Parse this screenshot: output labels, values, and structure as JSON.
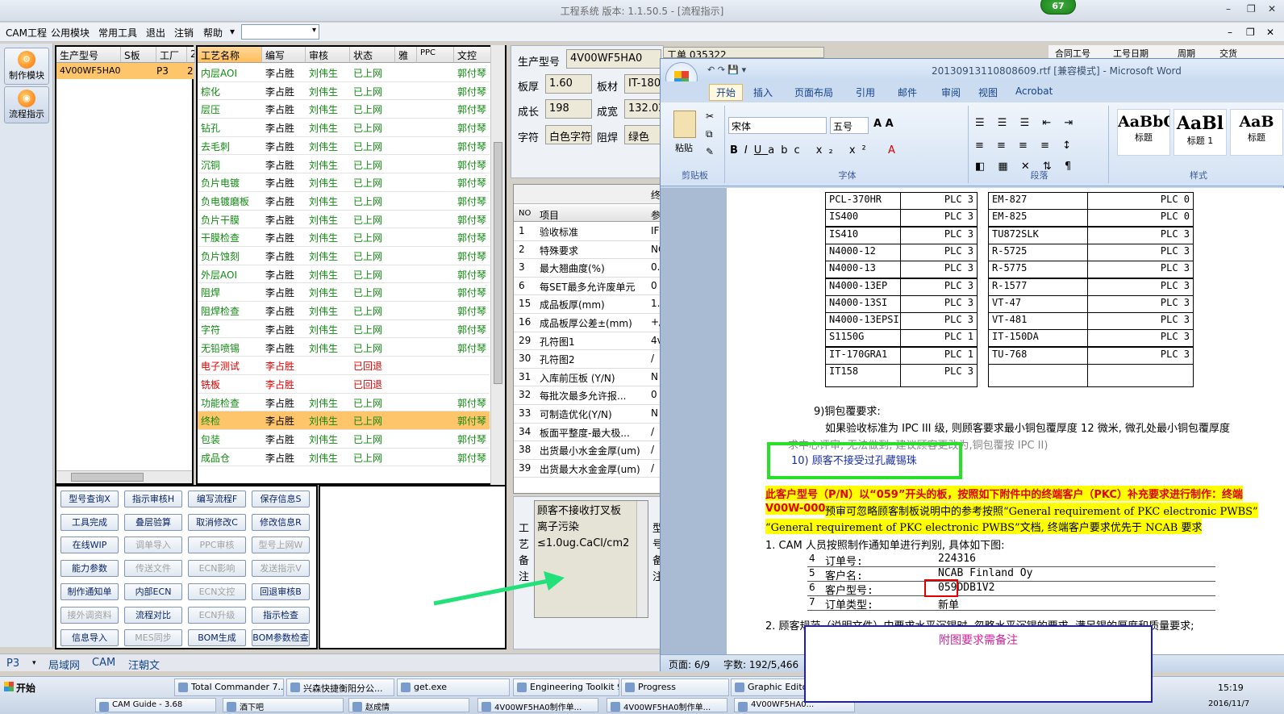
{
  "window": {
    "title": "工程系统  版本: 1.1.50.5 - [流程指示]",
    "badge": "67"
  },
  "menu": {
    "items": [
      "CAM工程",
      "公用模块",
      "常用工具",
      "退出",
      "注销",
      "帮助"
    ],
    "dropdown_arrow": "▾",
    "combo_value": ""
  },
  "window_controls": {
    "min": "–",
    "restore": "❐",
    "close": "✕"
  },
  "leftbar": {
    "btn1": "制作模块",
    "btn2": "流程指示"
  },
  "order_grid": {
    "headers": [
      "生产型号",
      "S板",
      "工厂",
      "2"
    ],
    "row": {
      "model": "4V00WF5HA0",
      "factory": "P3",
      "extra": "2"
    }
  },
  "process_grid": {
    "headers": [
      "工艺名称",
      "编写",
      "审核",
      "状态",
      "雅",
      "PPC",
      "文控"
    ],
    "rows": [
      {
        "name": "内层AOI",
        "writer": "李占胜",
        "reviewer": "刘伟生",
        "status": "已上网",
        "doc": "郭付琴",
        "cls": "g"
      },
      {
        "name": "棕化",
        "writer": "李占胜",
        "reviewer": "刘伟生",
        "status": "已上网",
        "doc": "郭付琴",
        "cls": "g"
      },
      {
        "name": "层压",
        "writer": "李占胜",
        "reviewer": "刘伟生",
        "status": "已上网",
        "doc": "郭付琴",
        "cls": "g"
      },
      {
        "name": "钻孔",
        "writer": "李占胜",
        "reviewer": "刘伟生",
        "status": "已上网",
        "doc": "郭付琴",
        "cls": "g"
      },
      {
        "name": "去毛刺",
        "writer": "李占胜",
        "reviewer": "刘伟生",
        "status": "已上网",
        "doc": "郭付琴",
        "cls": "g"
      },
      {
        "name": "沉铜",
        "writer": "李占胜",
        "reviewer": "刘伟生",
        "status": "已上网",
        "doc": "郭付琴",
        "cls": "g"
      },
      {
        "name": "负片电镀",
        "writer": "李占胜",
        "reviewer": "刘伟生",
        "status": "已上网",
        "doc": "郭付琴",
        "cls": "g"
      },
      {
        "name": "负电镀磨板",
        "writer": "李占胜",
        "reviewer": "刘伟生",
        "status": "已上网",
        "doc": "郭付琴",
        "cls": "g"
      },
      {
        "name": "负片干膜",
        "writer": "李占胜",
        "reviewer": "刘伟生",
        "status": "已上网",
        "doc": "郭付琴",
        "cls": "g"
      },
      {
        "name": "干膜检查",
        "writer": "李占胜",
        "reviewer": "刘伟生",
        "status": "已上网",
        "doc": "郭付琴",
        "cls": "g"
      },
      {
        "name": "负片蚀刻",
        "writer": "李占胜",
        "reviewer": "刘伟生",
        "status": "已上网",
        "doc": "郭付琴",
        "cls": "g"
      },
      {
        "name": "外层AOI",
        "writer": "李占胜",
        "reviewer": "刘伟生",
        "status": "已上网",
        "doc": "郭付琴",
        "cls": "g"
      },
      {
        "name": "阻焊",
        "writer": "李占胜",
        "reviewer": "刘伟生",
        "status": "已上网",
        "doc": "郭付琴",
        "cls": "g"
      },
      {
        "name": "阻焊检查",
        "writer": "李占胜",
        "reviewer": "刘伟生",
        "status": "已上网",
        "doc": "郭付琴",
        "cls": "g"
      },
      {
        "name": "字符",
        "writer": "李占胜",
        "reviewer": "刘伟生",
        "status": "已上网",
        "doc": "郭付琴",
        "cls": "g"
      },
      {
        "name": "无铅喷锡",
        "writer": "李占胜",
        "reviewer": "刘伟生",
        "status": "已上网",
        "doc": "郭付琴",
        "cls": "g"
      },
      {
        "name": "电子测试",
        "writer": "李占胜",
        "reviewer": "",
        "status": "已回退",
        "doc": "",
        "cls": "r"
      },
      {
        "name": "铣板",
        "writer": "李占胜",
        "reviewer": "",
        "status": "已回退",
        "doc": "",
        "cls": "r"
      },
      {
        "name": "功能检查",
        "writer": "李占胜",
        "reviewer": "刘伟生",
        "status": "已上网",
        "doc": "郭付琴",
        "cls": "g"
      },
      {
        "name": "终检",
        "writer": "李占胜",
        "reviewer": "刘伟生",
        "status": "已上网",
        "doc": "郭付琴",
        "cls": "g",
        "selected": true
      },
      {
        "name": "包装",
        "writer": "李占胜",
        "reviewer": "刘伟生",
        "status": "已上网",
        "doc": "郭付琴",
        "cls": "g"
      },
      {
        "name": "成品仓",
        "writer": "李占胜",
        "reviewer": "刘伟生",
        "status": "已上网",
        "doc": "郭付琴",
        "cls": "g"
      }
    ]
  },
  "buttons": [
    {
      "label": "型号查询X",
      "dis": false
    },
    {
      "label": "指示审核H",
      "dis": false
    },
    {
      "label": "编写流程F",
      "dis": false
    },
    {
      "label": "保存信息S",
      "dis": false
    },
    {
      "label": "工具完成",
      "dis": false
    },
    {
      "label": "叠层验算",
      "dis": false
    },
    {
      "label": "取消修改C",
      "dis": false
    },
    {
      "label": "修改信息R",
      "dis": false
    },
    {
      "label": "在线WIP",
      "dis": false
    },
    {
      "label": "调单导入",
      "dis": true
    },
    {
      "label": "PPC审核",
      "dis": true
    },
    {
      "label": "型号上网W",
      "dis": true
    },
    {
      "label": "能力参数",
      "dis": false
    },
    {
      "label": "传送文件",
      "dis": true
    },
    {
      "label": "ECN影响",
      "dis": true
    },
    {
      "label": "发送指示V",
      "dis": true
    },
    {
      "label": "制作通知单",
      "dis": false
    },
    {
      "label": "内部ECN",
      "dis": false
    },
    {
      "label": "ECN文控",
      "dis": true
    },
    {
      "label": "回退审核B",
      "dis": false
    },
    {
      "label": "接外调资料",
      "dis": true
    },
    {
      "label": "流程对比",
      "dis": false
    },
    {
      "label": "ECN升级",
      "dis": true
    },
    {
      "label": "指示检查",
      "dis": false
    },
    {
      "label": "信息导入",
      "dis": false
    },
    {
      "label": "MES同步",
      "dis": true
    },
    {
      "label": "BOM生成",
      "dis": false
    },
    {
      "label": "BOM参数检查",
      "dis": false
    }
  ],
  "detail": {
    "model_label": "生产型号",
    "model_value": "4V00WF5HA0",
    "gongdan_label": "工单",
    "gongdan_value": "035322",
    "thick_label": "板厚",
    "thick_value": "1.60",
    "mat_label": "板材",
    "mat_value": "IT-180",
    "len_label": "成长",
    "len_value": "198",
    "width_label": "成宽",
    "width_value": "132.02",
    "char_label": "字符",
    "char_value": "白色字符",
    "mask_label": "阻焊",
    "mask_value": "绿色",
    "table_title": "终",
    "table_headers": [
      "NO",
      "项目",
      "参"
    ],
    "table_rows": [
      {
        "no": "1",
        "item": "验收标准",
        "val": "IF"
      },
      {
        "no": "2",
        "item": "特殊要求",
        "val": "NC"
      },
      {
        "no": "3",
        "item": "最大翘曲度(%)",
        "val": "0."
      },
      {
        "no": "6",
        "item": "每SET最多允许废单元",
        "val": "0"
      },
      {
        "no": "15",
        "item": "成品板厚(mm)",
        "val": "1."
      },
      {
        "no": "16",
        "item": "成品板厚公差±(mm)",
        "val": "+/"
      },
      {
        "no": "29",
        "item": "孔符图1",
        "val": "4v"
      },
      {
        "no": "30",
        "item": "孔符图2",
        "val": "/"
      },
      {
        "no": "31",
        "item": "入库前压板 (Y/N)",
        "val": "N"
      },
      {
        "no": "32",
        "item": "每批次最多允许报...",
        "val": "0"
      },
      {
        "no": "33",
        "item": "可制造优化(Y/N)",
        "val": "N"
      },
      {
        "no": "34",
        "item": "板面平整度-最大极...",
        "val": "/"
      },
      {
        "no": "38",
        "item": "出货最小水金金厚(um)",
        "val": "/"
      },
      {
        "no": "39",
        "item": "出货最大水金金厚(um)",
        "val": "/"
      }
    ],
    "remark_side": [
      "工",
      "艺",
      "备",
      "注"
    ],
    "remark_side2": [
      "型",
      "号",
      "备",
      "注"
    ],
    "remark_text": [
      "顾客不接收打叉板",
      "离子污染",
      "≤1.0ug.CaCl/cm2"
    ]
  },
  "right_hdr": [
    "合同工号",
    "工号日期",
    "周期",
    "交货"
  ],
  "word": {
    "title": "20130913110808609.rtf [兼容模式] - Microsoft Word",
    "tabs": [
      "开始",
      "插入",
      "页面布局",
      "引用",
      "邮件",
      "审阅",
      "视图",
      "Acrobat"
    ],
    "clipboard": "剪贴板",
    "paste": "粘贴",
    "font_group": "字体",
    "para_group": "段落",
    "style_group": "样式",
    "font_name": "宋体",
    "font_size": "五号",
    "styles": [
      {
        "sample": "AaBbC",
        "name": "标题"
      },
      {
        "sample": "AaBl",
        "name": "标题 1"
      },
      {
        "sample": "AaB",
        "name": "标题"
      }
    ],
    "table_left": [
      [
        "PCL-370HR",
        "PLC 3"
      ],
      [
        "IS400",
        "PLC 3"
      ],
      [
        "IS410",
        "PLC 3"
      ],
      [
        "N4000-12",
        "PLC 3"
      ],
      [
        "N4000-13",
        "PLC 3"
      ],
      [
        "N4000-13EP",
        "PLC 3"
      ],
      [
        "N4000-13SI",
        "PLC 3"
      ],
      [
        "N4000-13EPSI",
        "PLC 3"
      ],
      [
        "S1150G",
        "PLC 1"
      ],
      [
        "IT-170GRA1",
        "PLC 1"
      ],
      [
        "IT158",
        "PLC 3"
      ]
    ],
    "table_right": [
      [
        "EM-827",
        "PLC 0"
      ],
      [
        "EM-825",
        "PLC 0"
      ],
      [
        "TU872SLK",
        "PLC 3"
      ],
      [
        "R-5725",
        "PLC 3"
      ],
      [
        "R-5775",
        "PLC 3"
      ],
      [
        "R-1577",
        "PLC 3"
      ],
      [
        "VT-47",
        "PLC 3"
      ],
      [
        "VT-481",
        "PLC 3"
      ],
      [
        "IT-150DA",
        "PLC 3"
      ],
      [
        "TU-768",
        "PLC 3"
      ],
      [
        "",
        ""
      ]
    ],
    "p9_title": "9)铜包覆要求:",
    "p9_body": "如果验收标准为 IPC III 级, 则顾客要求最小铜包覆厚度 12 微米, 微孔处最小铜包覆厚度",
    "p9_body2": "求中心评审, 无法做到, 建议顾客更改为,铜包覆按 IPC II)",
    "p10": "10) 顾客不接受过孔藏锡珠",
    "red1": "此客户型号（P/N）以“059”开头的板，按照如下附件中的终端客户（PKC）补充要求进行制作：终端",
    "red2a": "V00W-0001",
    "red2b": "预审可忽略顾客制板说明中的参考按照“General requirement of PKC electronic PWBS”",
    "red3": "“General requirement of PKC electronic PWBS”文档, 终端客户要求优先于 NCAB 要求",
    "li1": "1.   CAM 人员按照制作通知单进行判别, 具体如下图:",
    "mini": [
      {
        "n": "4",
        "k": "订单号:",
        "v": "224316"
      },
      {
        "n": "5",
        "k": "客户名:",
        "v": "NCAB Finland Oy"
      },
      {
        "n": "6",
        "k": "客户型号:",
        "v": "059DDB1V2"
      },
      {
        "n": "7",
        "k": "订单类型:",
        "v": "新单"
      }
    ],
    "li2": "2.   顾客规范（说明文件）中要求水平沉锡时, 忽略水平沉锡的要求, 满足锡的厚度和质量要求;",
    "status_page": "页面: 6/9",
    "status_words": "字数: 192/5,466"
  },
  "overlay_text": "附图要求需备注",
  "bottom_tabs": [
    "P3",
    "局域网",
    "CAM",
    "汪朝文"
  ],
  "taskbar": {
    "start": "开始",
    "tasks": [
      "Total Commander 7....",
      "兴森快捷衡阳分公...",
      "get.exe",
      "Engineering Toolkit 9...",
      "Progress",
      "Graphic Editor"
    ],
    "tasks2": [
      "CAM Guide - 3.68",
      "酒下吧",
      "赵成情",
      "4V00WF5HA0制作单...",
      "4V00WF5HA0制作单...",
      "4V00WF5HA0..."
    ],
    "time": "15:19",
    "date": "2016/11/7"
  },
  "colors": {
    "green": "#118a11",
    "red": "#e00000",
    "selected": "#ffc56b",
    "arrow": "#22e07a"
  }
}
